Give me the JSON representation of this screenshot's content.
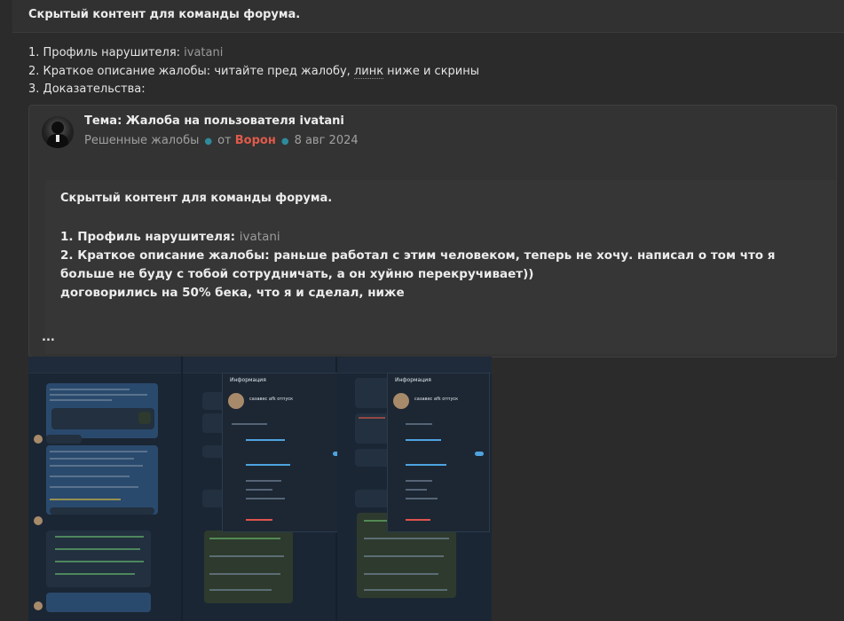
{
  "hidden_banner": {
    "text": "Скрытый контент для команды форума."
  },
  "report": {
    "line1_prefix": "1. Профиль нарушителя: ",
    "line1_user": "ivatani",
    "line2_prefix": "2. Краткое описание жалобы: читайте пред жалобу, ",
    "line2_link": "линк",
    "line2_suffix": " ниже и скрины",
    "line3": "3. Доказательства:"
  },
  "quote": {
    "title": "Тема: Жалоба на пользователя ivatani",
    "category": "Решенные жалобы",
    "from_label": "от",
    "author": "Ворон",
    "date": "8 авг 2024",
    "inner_hidden_title": "Скрытый контент для команды форума.",
    "inner_line1_prefix": "1. Профиль нарушителя: ",
    "inner_line1_user": "ivatani",
    "inner_line2": "2. Краткое описание жалобы: раньше работал с этим человеком, теперь не хочу. написал о том что я больше не буду с тобой сотрудничать, а он хуйню перекручивает))",
    "inner_line3": "договорились на 50% бека, что я и сделал, ниже",
    "ellipsis": "..."
  },
  "screenshot": {
    "popup_title_1": "Информация",
    "popup_title_2": "Информация",
    "contact_name": "сазавес afk отпуск",
    "colors": {
      "bg": "#16202c",
      "bubble_out": "#2a4a6d",
      "bubble_in": "#22303f",
      "link": "#4ea3e0",
      "danger": "#e0534d"
    }
  }
}
